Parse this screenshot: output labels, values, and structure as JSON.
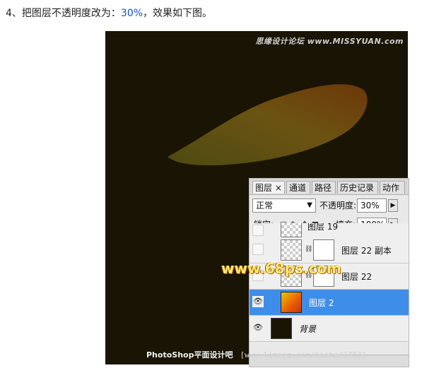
{
  "instruction": {
    "prefix": "4、把图层不透明度改为：",
    "value": "30%",
    "suffix": "，效果如下图。"
  },
  "canvas": {
    "background": "#1a1405",
    "watermark_top": "思缘设计论坛 www.MISSYUAN.com"
  },
  "panel": {
    "tabs": [
      {
        "label": "图层 ×",
        "active": true
      },
      {
        "label": "通道",
        "active": false
      },
      {
        "label": "路径",
        "active": false
      },
      {
        "label": "历史记录",
        "active": false
      },
      {
        "label": "动作",
        "active": false
      }
    ],
    "blend_mode": "正常",
    "opacity_label": "不透明度:",
    "opacity_value": "30%",
    "lock_label": "锁定:",
    "fill_label": "填充:",
    "fill_value": "100%",
    "layers": [
      {
        "name": "图层 19",
        "visible": false
      },
      {
        "name": "图层 22 副本",
        "visible": false,
        "has_mask": true
      },
      {
        "name": "图层 22",
        "visible": false,
        "has_mask": true
      },
      {
        "name": "图层 2",
        "visible": true,
        "selected": true
      },
      {
        "name": "背景",
        "visible": true,
        "italic": true
      }
    ]
  },
  "watermarks": {
    "mid": "www.68ps.com",
    "bottom_left": "PhotoShop平面设计吧",
    "bottom_site": "[www.lineeg.com/tieba/1783]"
  },
  "colors": {
    "accent_selected": "#3e8ee9",
    "shape_gradient_start": "#4d4a12",
    "shape_gradient_end": "#6d3708"
  }
}
